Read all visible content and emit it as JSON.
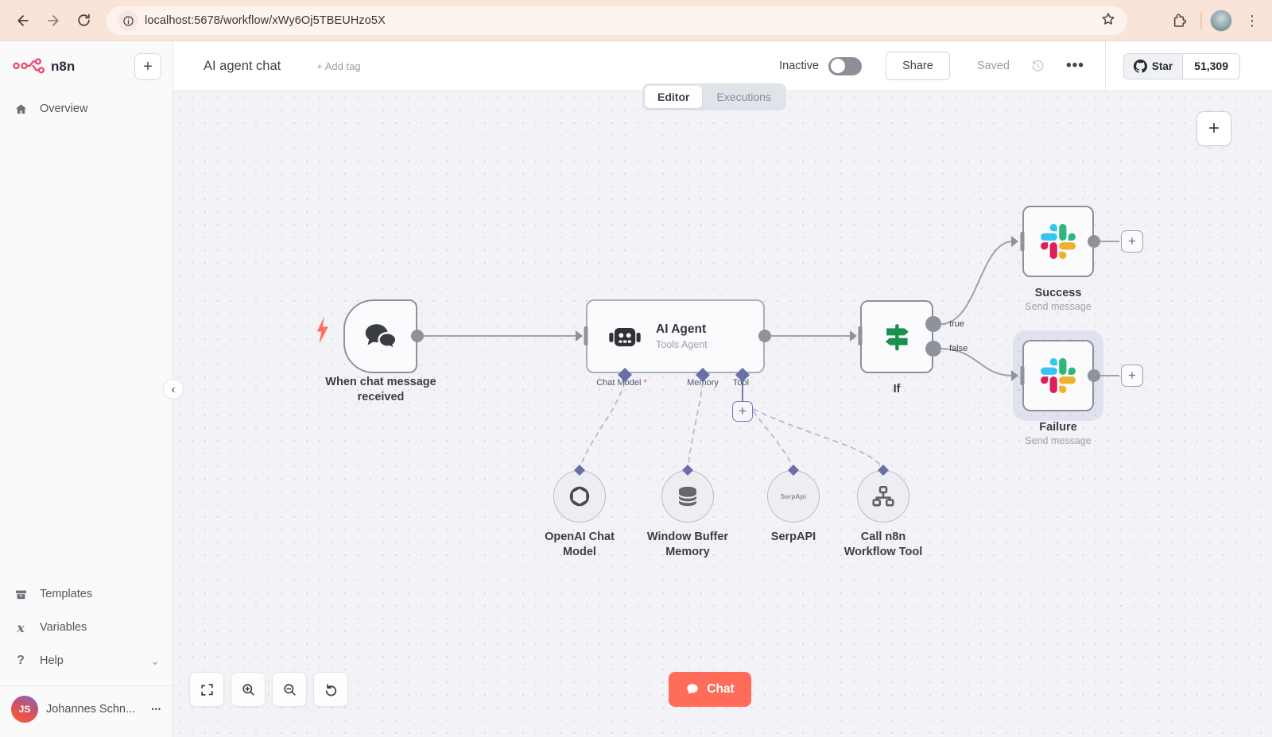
{
  "browser": {
    "url": "localhost:5678/workflow/xWy6Oj5TBEUHzo5X"
  },
  "sidebar": {
    "logo_text": "n8n",
    "items": [
      {
        "label": "Overview"
      },
      {
        "label": "Templates"
      },
      {
        "label": "Variables"
      },
      {
        "label": "Help"
      }
    ],
    "user": {
      "initials": "JS",
      "name": "Johannes Schn..."
    }
  },
  "header": {
    "title": "AI agent chat",
    "add_tag_label": "+ Add tag",
    "status_label": "Inactive",
    "share_label": "Share",
    "saved_label": "Saved",
    "github": {
      "star_label": "Star",
      "star_count": "51,309"
    }
  },
  "tabs": {
    "editor_label": "Editor",
    "executions_label": "Executions"
  },
  "workflow": {
    "trigger": {
      "label": "When chat message received"
    },
    "agent": {
      "title": "AI Agent",
      "subtitle": "Tools Agent",
      "ports": [
        {
          "label": "Chat Model",
          "required": "*"
        },
        {
          "label": "Memory"
        },
        {
          "label": "Tool"
        }
      ]
    },
    "if_node": {
      "label": "If",
      "outputs": [
        {
          "label": "true"
        },
        {
          "label": "false"
        }
      ]
    },
    "success": {
      "label": "Success",
      "sublabel": "Send message"
    },
    "failure": {
      "label": "Failure",
      "sublabel": "Send message"
    },
    "subnodes": [
      {
        "label": "OpenAI Chat Model"
      },
      {
        "label": "Window Buffer Memory"
      },
      {
        "label": "SerpAPI",
        "icon_text": "SerpApi"
      },
      {
        "label": "Call n8n Workflow Tool"
      }
    ],
    "chat_button_label": "Chat"
  },
  "icons": {
    "plus": "+",
    "kebab_vertical": "⋮",
    "kebab_horizontal": "•••",
    "ellipsis_small": "•••",
    "chevron_left": "‹",
    "chevron_down": "⌄",
    "variables_glyph": "x",
    "help_glyph": "?"
  },
  "colors": {
    "accent_n8n": "#ea4b71",
    "chat_button": "#ff6d5a",
    "if_green": "#17914b",
    "slack_blue": "#36C5F0",
    "slack_green": "#2EB67D",
    "slack_yellow": "#ECB22E",
    "slack_red": "#E01E5A",
    "connector_purple": "#6a6fa9",
    "edge_gray": "#9fa2a9"
  }
}
